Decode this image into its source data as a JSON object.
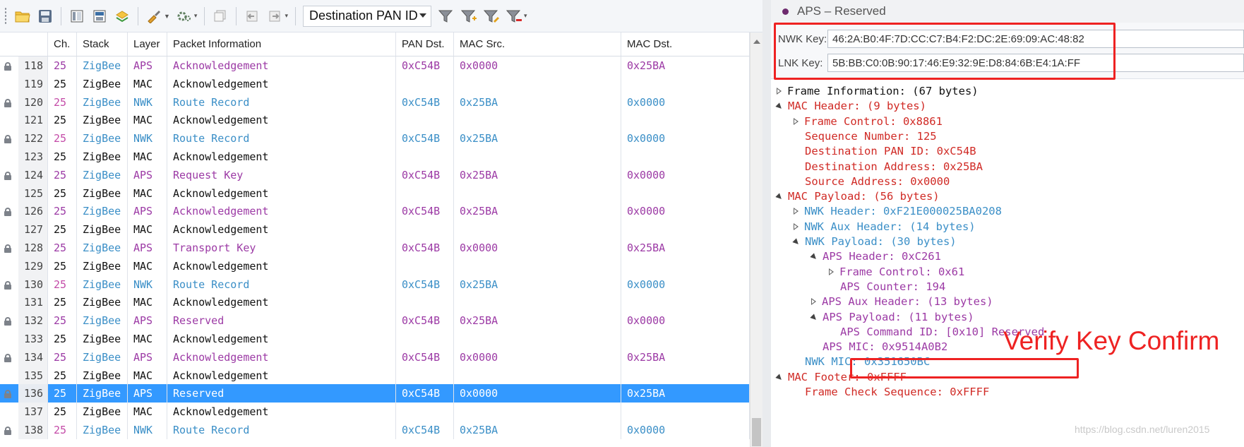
{
  "toolbar": {
    "filter_field": "Destination PAN ID",
    "icons": [
      "open-folder-icon",
      "save-icon",
      "columns-icon",
      "save-as-icon",
      "export-icon",
      "brush-icon",
      "gear-settings-icon",
      "copy-icon",
      "back-icon",
      "forward-icon",
      "filter-icon",
      "filter-add-icon",
      "filter-edit-icon",
      "filter-remove-icon"
    ]
  },
  "packet_table": {
    "headers": [
      "Ch.",
      "Stack",
      "Layer",
      "Packet Information",
      "PAN Dst.",
      "MAC Src.",
      "MAC Dst."
    ],
    "rows": [
      {
        "no": "118",
        "ch": "25",
        "stack": "ZigBee",
        "layer": "APS",
        "info": "Acknowledgement",
        "pan": "0xC54B",
        "src": "0x0000",
        "dst": "0x25BA",
        "locked": true,
        "kind": "aps"
      },
      {
        "no": "119",
        "ch": "25",
        "stack": "ZigBee",
        "layer": "MAC",
        "info": "Acknowledgement",
        "pan": "",
        "src": "",
        "dst": "",
        "locked": false,
        "kind": "plain"
      },
      {
        "no": "120",
        "ch": "25",
        "stack": "ZigBee",
        "layer": "NWK",
        "info": "Route Record",
        "pan": "0xC54B",
        "src": "0x25BA",
        "dst": "0x0000",
        "locked": true,
        "kind": "enc"
      },
      {
        "no": "121",
        "ch": "25",
        "stack": "ZigBee",
        "layer": "MAC",
        "info": "Acknowledgement",
        "pan": "",
        "src": "",
        "dst": "",
        "locked": false,
        "kind": "plain"
      },
      {
        "no": "122",
        "ch": "25",
        "stack": "ZigBee",
        "layer": "NWK",
        "info": "Route Record",
        "pan": "0xC54B",
        "src": "0x25BA",
        "dst": "0x0000",
        "locked": true,
        "kind": "enc"
      },
      {
        "no": "123",
        "ch": "25",
        "stack": "ZigBee",
        "layer": "MAC",
        "info": "Acknowledgement",
        "pan": "",
        "src": "",
        "dst": "",
        "locked": false,
        "kind": "plain"
      },
      {
        "no": "124",
        "ch": "25",
        "stack": "ZigBee",
        "layer": "APS",
        "info": "Request Key",
        "pan": "0xC54B",
        "src": "0x25BA",
        "dst": "0x0000",
        "locked": true,
        "kind": "aps"
      },
      {
        "no": "125",
        "ch": "25",
        "stack": "ZigBee",
        "layer": "MAC",
        "info": "Acknowledgement",
        "pan": "",
        "src": "",
        "dst": "",
        "locked": false,
        "kind": "plain"
      },
      {
        "no": "126",
        "ch": "25",
        "stack": "ZigBee",
        "layer": "APS",
        "info": "Acknowledgement",
        "pan": "0xC54B",
        "src": "0x25BA",
        "dst": "0x0000",
        "locked": true,
        "kind": "aps"
      },
      {
        "no": "127",
        "ch": "25",
        "stack": "ZigBee",
        "layer": "MAC",
        "info": "Acknowledgement",
        "pan": "",
        "src": "",
        "dst": "",
        "locked": false,
        "kind": "plain"
      },
      {
        "no": "128",
        "ch": "25",
        "stack": "ZigBee",
        "layer": "APS",
        "info": "Transport Key",
        "pan": "0xC54B",
        "src": "0x0000",
        "dst": "0x25BA",
        "locked": true,
        "kind": "aps"
      },
      {
        "no": "129",
        "ch": "25",
        "stack": "ZigBee",
        "layer": "MAC",
        "info": "Acknowledgement",
        "pan": "",
        "src": "",
        "dst": "",
        "locked": false,
        "kind": "plain"
      },
      {
        "no": "130",
        "ch": "25",
        "stack": "ZigBee",
        "layer": "NWK",
        "info": "Route Record",
        "pan": "0xC54B",
        "src": "0x25BA",
        "dst": "0x0000",
        "locked": true,
        "kind": "enc"
      },
      {
        "no": "131",
        "ch": "25",
        "stack": "ZigBee",
        "layer": "MAC",
        "info": "Acknowledgement",
        "pan": "",
        "src": "",
        "dst": "",
        "locked": false,
        "kind": "plain"
      },
      {
        "no": "132",
        "ch": "25",
        "stack": "ZigBee",
        "layer": "APS",
        "info": "Reserved",
        "pan": "0xC54B",
        "src": "0x25BA",
        "dst": "0x0000",
        "locked": true,
        "kind": "aps"
      },
      {
        "no": "133",
        "ch": "25",
        "stack": "ZigBee",
        "layer": "MAC",
        "info": "Acknowledgement",
        "pan": "",
        "src": "",
        "dst": "",
        "locked": false,
        "kind": "plain"
      },
      {
        "no": "134",
        "ch": "25",
        "stack": "ZigBee",
        "layer": "APS",
        "info": "Acknowledgement",
        "pan": "0xC54B",
        "src": "0x0000",
        "dst": "0x25BA",
        "locked": true,
        "kind": "aps"
      },
      {
        "no": "135",
        "ch": "25",
        "stack": "ZigBee",
        "layer": "MAC",
        "info": "Acknowledgement",
        "pan": "",
        "src": "",
        "dst": "",
        "locked": false,
        "kind": "plain"
      },
      {
        "no": "136",
        "ch": "25",
        "stack": "ZigBee",
        "layer": "APS",
        "info": "Reserved",
        "pan": "0xC54B",
        "src": "0x0000",
        "dst": "0x25BA",
        "locked": true,
        "kind": "selected"
      },
      {
        "no": "137",
        "ch": "25",
        "stack": "ZigBee",
        "layer": "MAC",
        "info": "Acknowledgement",
        "pan": "",
        "src": "",
        "dst": "",
        "locked": false,
        "kind": "plain"
      },
      {
        "no": "138",
        "ch": "25",
        "stack": "ZigBee",
        "layer": "NWK",
        "info": "Route Record",
        "pan": "0xC54B",
        "src": "0x25BA",
        "dst": "0x0000",
        "locked": true,
        "kind": "enc"
      }
    ]
  },
  "detail": {
    "title": "APS – Reserved",
    "nwk_key_label": "NWK Key:",
    "nwk_key": "46:2A:B0:4F:7D:CC:C7:B4:F2:DC:2E:69:09:AC:48:82",
    "lnk_key_label": "LNK Key:",
    "lnk_key": "5B:BB:C0:0B:90:17:46:E9:32:9E:D8:84:6B:E4:1A:FF",
    "tree": [
      {
        "text": "Frame Information: (67 bytes)",
        "level": 0,
        "toggle": "closed",
        "color": "black"
      },
      {
        "text": "MAC Header: (9 bytes)",
        "level": 0,
        "toggle": "open",
        "color": "red"
      },
      {
        "text": "Frame Control: 0x8861",
        "level": 1,
        "toggle": "closed",
        "color": "red"
      },
      {
        "text": "Sequence Number: 125",
        "level": 1,
        "toggle": "none",
        "color": "red"
      },
      {
        "text": "Destination PAN ID: 0xC54B",
        "level": 1,
        "toggle": "none",
        "color": "red"
      },
      {
        "text": "Destination Address: 0x25BA",
        "level": 1,
        "toggle": "none",
        "color": "red"
      },
      {
        "text": "Source Address: 0x0000",
        "level": 1,
        "toggle": "none",
        "color": "red"
      },
      {
        "text": "MAC Payload: (56 bytes)",
        "level": 0,
        "toggle": "open",
        "color": "red"
      },
      {
        "text": "NWK Header: 0xF21E000025BA0208",
        "level": 1,
        "toggle": "closed",
        "color": "blue"
      },
      {
        "text": "NWK Aux Header: (14 bytes)",
        "level": 1,
        "toggle": "closed",
        "color": "blue"
      },
      {
        "text": "NWK Payload: (30 bytes)",
        "level": 1,
        "toggle": "open",
        "color": "blue"
      },
      {
        "text": "APS Header: 0xC261",
        "level": 2,
        "toggle": "open",
        "color": "purple"
      },
      {
        "text": "Frame Control: 0x61",
        "level": 3,
        "toggle": "closed",
        "color": "purple"
      },
      {
        "text": "APS Counter: 194",
        "level": 3,
        "toggle": "none",
        "color": "purple"
      },
      {
        "text": "APS Aux Header: (13 bytes)",
        "level": 2,
        "toggle": "closed",
        "color": "purple"
      },
      {
        "text": "APS Payload: (11 bytes)",
        "level": 2,
        "toggle": "open",
        "color": "purple"
      },
      {
        "text": "APS Command ID: [0x10] Reserved",
        "level": 3,
        "toggle": "none",
        "color": "purple"
      },
      {
        "text": "APS MIC: 0x9514A0B2",
        "level": 2,
        "toggle": "none",
        "color": "purple"
      },
      {
        "text": "NWK MIC: 0x351650BC",
        "level": 1,
        "toggle": "none",
        "color": "blue"
      },
      {
        "text": "MAC Footer: 0xFFFF",
        "level": 0,
        "toggle": "open",
        "color": "red"
      },
      {
        "text": "Frame Check Sequence: 0xFFFF",
        "level": 1,
        "toggle": "none",
        "color": "red"
      }
    ]
  },
  "annotation": {
    "text": "Verify Key Confirm",
    "color": "#ee2222"
  },
  "watermark": "https://blog.csdn.net/luren2015",
  "colors": {
    "selected_row": "#3399ff",
    "nwk_blue": "#3b8fc7",
    "aps_purple": "#9c3aa5",
    "mac_red": "#d02a25"
  }
}
